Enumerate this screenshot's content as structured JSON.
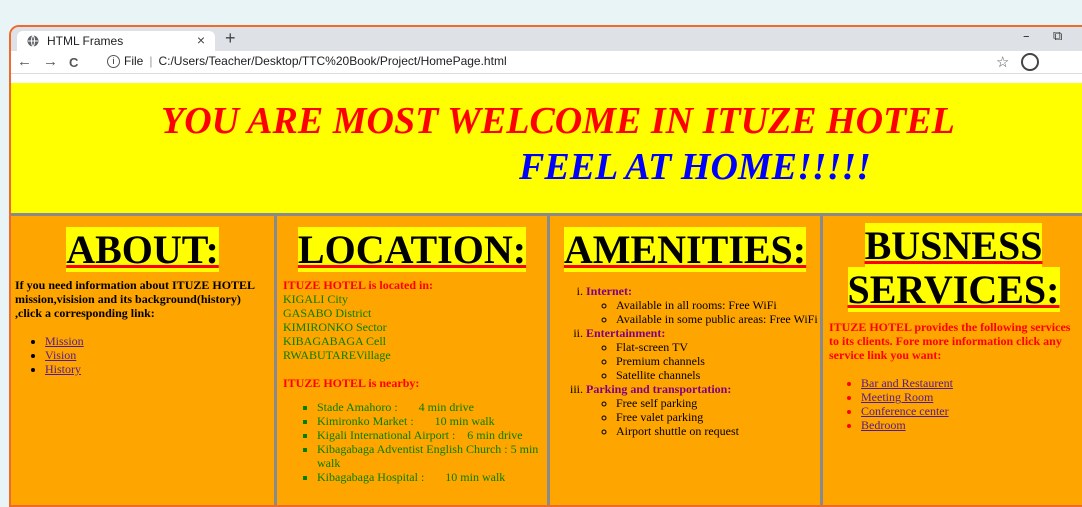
{
  "browser": {
    "tab_title": "HTML Frames",
    "tab_close": "×",
    "new_tab": "+",
    "back": "←",
    "forward": "→",
    "reload": "C",
    "address_scheme": "File",
    "address": "C:/Users/Teacher/Desktop/TTC%20Book/Project/HomePage.html",
    "bookmark": "☆",
    "minimize": "–",
    "restore": "⧉"
  },
  "banner": {
    "line1": "YOU ARE MOST WELCOME IN ITUZE HOTEL",
    "line2": "FEEL AT HOME!!!!!",
    "colors": {
      "background": "#ffff00",
      "line1": "#ff0000",
      "line2": "#0000ff"
    }
  },
  "about": {
    "heading": "ABOUT:",
    "intro": "If you need information about ITUZE HOTEL mission,visision and its background(history) ,click a corresponding link:",
    "links": [
      "Mission",
      "Vision",
      "History"
    ]
  },
  "location": {
    "heading": "LOCATION:",
    "located_title": "ITUZE HOTEL is located in:",
    "address_lines": [
      "KIGALI City",
      "GASABO District",
      "KIMIRONKO Sector",
      "KIBAGABAGA Cell",
      "RWABUTAREVillage"
    ],
    "nearby_title": "ITUZE HOTEL is nearby:",
    "nearby": [
      "Stade Amahoro :       4 min drive",
      "Kimironko Market :       10 min walk",
      "Kigali International Airport :    6 min drive",
      "Kibagabaga Adventist English Church : 5 min walk",
      "Kibagabaga Hospital :       10 min walk"
    ]
  },
  "amenities": {
    "heading": "AMENITIES:",
    "groups": [
      {
        "title": "Internet:",
        "items": [
          "Available in all rooms: Free WiFi",
          "Available in some public areas: Free WiFi"
        ]
      },
      {
        "title": "Entertainment:",
        "items": [
          "Flat-screen TV",
          "Premium channels",
          "Satellite channels"
        ]
      },
      {
        "title": "Parking and transportation:",
        "items": [
          "Free self parking",
          "Free valet parking",
          "Airport shuttle on request"
        ]
      }
    ]
  },
  "business": {
    "heading_line1": "BUSNESS",
    "heading_line2": "SERVICES:",
    "intro": "ITUZE HOTEL provides the following services to its clients. Fore more information click any service link you want:",
    "links": [
      "Bar and Restaurent",
      "Meeting Room",
      "Conference center",
      "Bedroom"
    ]
  },
  "colors": {
    "panel": "#ffa500",
    "heading_bg": "#ffff00",
    "divider": "#8a8a8a",
    "frame_border": "#ef6b2d"
  }
}
